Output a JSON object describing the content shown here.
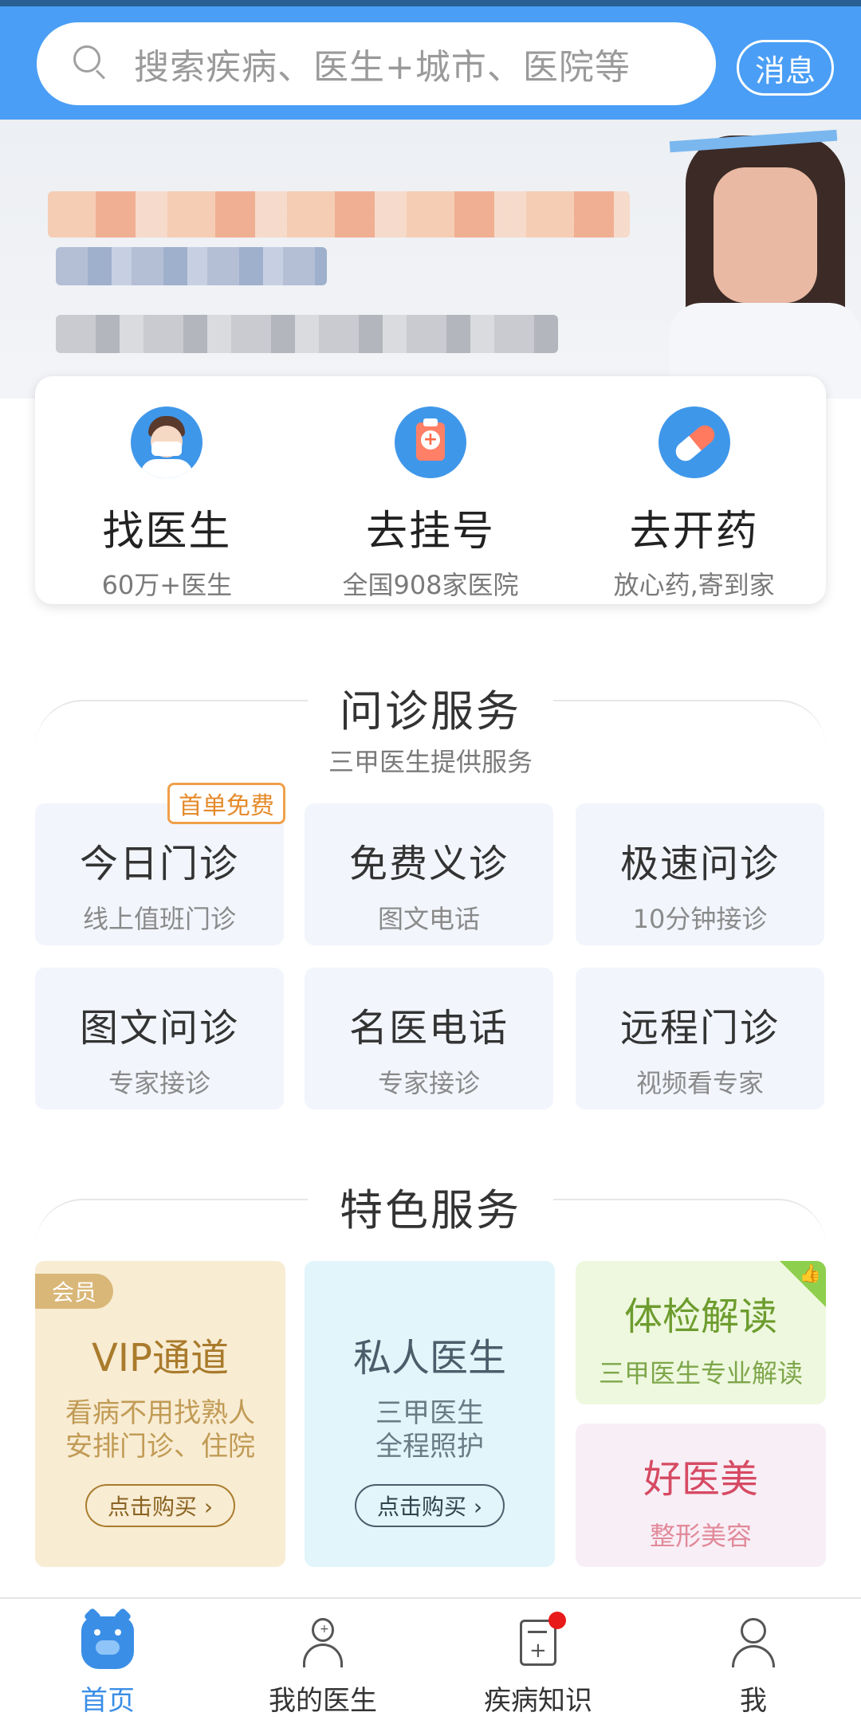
{
  "header": {
    "search_placeholder": "搜索疾病、医生+城市、医院等",
    "message_label": "消息"
  },
  "quick_entries": [
    {
      "title": "找医生",
      "subtitle": "60万+医生",
      "icon": "doctor-avatar-icon"
    },
    {
      "title": "去挂号",
      "subtitle": "全国908家医院",
      "icon": "clipboard-plus-icon"
    },
    {
      "title": "去开药",
      "subtitle": "放心药,寄到家",
      "icon": "pill-icon"
    }
  ],
  "consult_section": {
    "title": "问诊服务",
    "subtitle": "三甲医生提供服务",
    "badge": "首单免费",
    "items": [
      {
        "title": "今日门诊",
        "subtitle": "线上值班门诊"
      },
      {
        "title": "免费义诊",
        "subtitle": "图文电话"
      },
      {
        "title": "极速问诊",
        "subtitle": "10分钟接诊"
      },
      {
        "title": "图文问诊",
        "subtitle": "专家接诊"
      },
      {
        "title": "名医电话",
        "subtitle": "专家接诊"
      },
      {
        "title": "远程门诊",
        "subtitle": "视频看专家"
      }
    ]
  },
  "feature_section": {
    "title": "特色服务",
    "vip": {
      "tag": "会员",
      "title": "VIP通道",
      "line1": "看病不用找熟人",
      "line2": "安排门诊、住院",
      "button": "点击购买 ›"
    },
    "private_doctor": {
      "title": "私人医生",
      "line1": "三甲医生",
      "line2": "全程照护",
      "button": "点击购买 ›"
    },
    "checkup": {
      "title": "体检解读",
      "subtitle": "三甲医生专业解读"
    },
    "beauty": {
      "title": "好医美",
      "subtitle": "整形美容"
    }
  },
  "bottom_nav": [
    {
      "label": "首页",
      "active": true
    },
    {
      "label": "我的医生",
      "active": false
    },
    {
      "label": "疾病知识",
      "active": false,
      "has_badge": true
    },
    {
      "label": "我",
      "active": false
    }
  ],
  "colors": {
    "header_blue": "#4a9ef5",
    "active_nav": "#3a8ee6",
    "badge_orange": "#f0a04a"
  }
}
